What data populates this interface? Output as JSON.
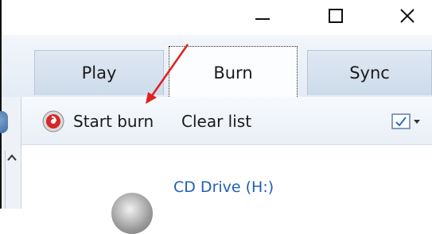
{
  "window": {
    "minimize_icon": "minimize-icon",
    "maximize_icon": "maximize-icon",
    "close_icon": "close-icon"
  },
  "tabs": [
    {
      "label": "Play",
      "active": false
    },
    {
      "label": "Burn",
      "active": true
    },
    {
      "label": "Sync",
      "active": false
    }
  ],
  "toolbar": {
    "start_burn_label": "Start burn",
    "clear_list_label": "Clear list",
    "burn_icon": "burn-icon",
    "options_icon": "burn-options-icon"
  },
  "content": {
    "drive_label": "CD Drive (H:)"
  },
  "colors": {
    "accent_link": "#1f5fb5",
    "annotation_arrow": "#e02020"
  }
}
